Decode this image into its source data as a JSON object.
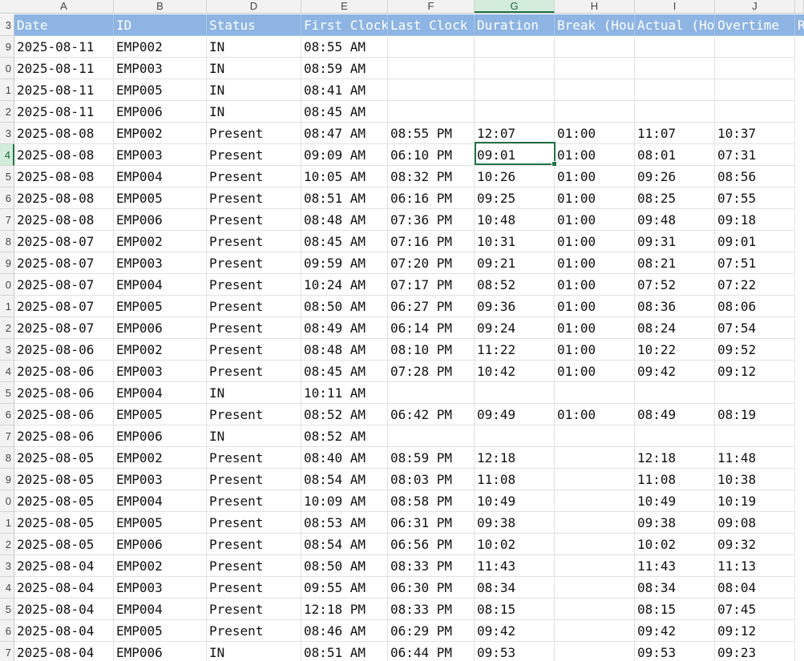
{
  "column_letters": [
    "A",
    "B",
    "D",
    "E",
    "F",
    "G",
    "H",
    "I",
    "J"
  ],
  "header_row_number": "3",
  "headers": [
    "Date",
    "ID",
    "Status",
    "First Clock",
    "Last Clock",
    "Duration",
    "Break (Hours)",
    "Actual (Hours)",
    "Overtime",
    "R"
  ],
  "rows": [
    {
      "n": "9",
      "c": [
        "2025-08-11",
        "EMP002",
        "IN",
        "08:55 AM",
        "",
        "",
        "",
        "",
        ""
      ]
    },
    {
      "n": "0",
      "c": [
        "2025-08-11",
        "EMP003",
        "IN",
        "08:59 AM",
        "",
        "",
        "",
        "",
        ""
      ]
    },
    {
      "n": "1",
      "c": [
        "2025-08-11",
        "EMP005",
        "IN",
        "08:41 AM",
        "",
        "",
        "",
        "",
        ""
      ]
    },
    {
      "n": "2",
      "c": [
        "2025-08-11",
        "EMP006",
        "IN",
        "08:45 AM",
        "",
        "",
        "",
        "",
        ""
      ]
    },
    {
      "n": "3",
      "c": [
        "2025-08-08",
        "EMP002",
        "Present",
        "08:47 AM",
        "08:55 PM",
        "12:07",
        "01:00",
        "11:07",
        "10:37"
      ]
    },
    {
      "n": "4",
      "c": [
        "2025-08-08",
        "EMP003",
        "Present",
        "09:09 AM",
        "06:10 PM",
        "09:01",
        "01:00",
        "08:01",
        "07:31"
      ]
    },
    {
      "n": "5",
      "c": [
        "2025-08-08",
        "EMP004",
        "Present",
        "10:05 AM",
        "08:32 PM",
        "10:26",
        "01:00",
        "09:26",
        "08:56"
      ]
    },
    {
      "n": "6",
      "c": [
        "2025-08-08",
        "EMP005",
        "Present",
        "08:51 AM",
        "06:16 PM",
        "09:25",
        "01:00",
        "08:25",
        "07:55"
      ]
    },
    {
      "n": "7",
      "c": [
        "2025-08-08",
        "EMP006",
        "Present",
        "08:48 AM",
        "07:36 PM",
        "10:48",
        "01:00",
        "09:48",
        "09:18"
      ]
    },
    {
      "n": "8",
      "c": [
        "2025-08-07",
        "EMP002",
        "Present",
        "08:45 AM",
        "07:16 PM",
        "10:31",
        "01:00",
        "09:31",
        "09:01"
      ]
    },
    {
      "n": "9",
      "c": [
        "2025-08-07",
        "EMP003",
        "Present",
        "09:59 AM",
        "07:20 PM",
        "09:21",
        "01:00",
        "08:21",
        "07:51"
      ]
    },
    {
      "n": "0",
      "c": [
        "2025-08-07",
        "EMP004",
        "Present",
        "10:24 AM",
        "07:17 PM",
        "08:52",
        "01:00",
        "07:52",
        "07:22"
      ]
    },
    {
      "n": "1",
      "c": [
        "2025-08-07",
        "EMP005",
        "Present",
        "08:50 AM",
        "06:27 PM",
        "09:36",
        "01:00",
        "08:36",
        "08:06"
      ]
    },
    {
      "n": "2",
      "c": [
        "2025-08-07",
        "EMP006",
        "Present",
        "08:49 AM",
        "06:14 PM",
        "09:24",
        "01:00",
        "08:24",
        "07:54"
      ]
    },
    {
      "n": "3",
      "c": [
        "2025-08-06",
        "EMP002",
        "Present",
        "08:48 AM",
        "08:10 PM",
        "11:22",
        "01:00",
        "10:22",
        "09:52"
      ]
    },
    {
      "n": "4",
      "c": [
        "2025-08-06",
        "EMP003",
        "Present",
        "08:45 AM",
        "07:28 PM",
        "10:42",
        "01:00",
        "09:42",
        "09:12"
      ]
    },
    {
      "n": "5",
      "c": [
        "2025-08-06",
        "EMP004",
        "IN",
        "10:11 AM",
        "",
        "",
        "",
        "",
        ""
      ]
    },
    {
      "n": "6",
      "c": [
        "2025-08-06",
        "EMP005",
        "Present",
        "08:52 AM",
        "06:42 PM",
        "09:49",
        "01:00",
        "08:49",
        "08:19"
      ]
    },
    {
      "n": "7",
      "c": [
        "2025-08-06",
        "EMP006",
        "IN",
        "08:52 AM",
        "",
        "",
        "",
        "",
        ""
      ]
    },
    {
      "n": "8",
      "c": [
        "2025-08-05",
        "EMP002",
        "Present",
        "08:40 AM",
        "08:59 PM",
        "12:18",
        "",
        "12:18",
        "11:48"
      ]
    },
    {
      "n": "9",
      "c": [
        "2025-08-05",
        "EMP003",
        "Present",
        "08:54 AM",
        "08:03 PM",
        "11:08",
        "",
        "11:08",
        "10:38"
      ]
    },
    {
      "n": "0",
      "c": [
        "2025-08-05",
        "EMP004",
        "Present",
        "10:09 AM",
        "08:58 PM",
        "10:49",
        "",
        "10:49",
        "10:19"
      ]
    },
    {
      "n": "1",
      "c": [
        "2025-08-05",
        "EMP005",
        "Present",
        "08:53 AM",
        "06:31 PM",
        "09:38",
        "",
        "09:38",
        "09:08"
      ]
    },
    {
      "n": "2",
      "c": [
        "2025-08-05",
        "EMP006",
        "Present",
        "08:54 AM",
        "06:56 PM",
        "10:02",
        "",
        "10:02",
        "09:32"
      ]
    },
    {
      "n": "3",
      "c": [
        "2025-08-04",
        "EMP002",
        "Present",
        "08:50 AM",
        "08:33 PM",
        "11:43",
        "",
        "11:43",
        "11:13"
      ]
    },
    {
      "n": "4",
      "c": [
        "2025-08-04",
        "EMP003",
        "Present",
        "09:55 AM",
        "06:30 PM",
        "08:34",
        "",
        "08:34",
        "08:04"
      ]
    },
    {
      "n": "5",
      "c": [
        "2025-08-04",
        "EMP004",
        "Present",
        "12:18 PM",
        "08:33 PM",
        "08:15",
        "",
        "08:15",
        "07:45"
      ]
    },
    {
      "n": "6",
      "c": [
        "2025-08-04",
        "EMP005",
        "Present",
        "08:46 AM",
        "06:29 PM",
        "09:42",
        "",
        "09:42",
        "09:12"
      ]
    },
    {
      "n": "7",
      "c": [
        "2025-08-04",
        "EMP006",
        "IN",
        "08:51 AM",
        "06:44 PM",
        "09:53",
        "",
        "09:53",
        "09:23"
      ]
    }
  ],
  "active_cell": {
    "column": "G",
    "row_index": 5
  },
  "colors": {
    "header_fill": "#8db4e2",
    "header_text": "#ffffff",
    "selection": "#217346"
  }
}
